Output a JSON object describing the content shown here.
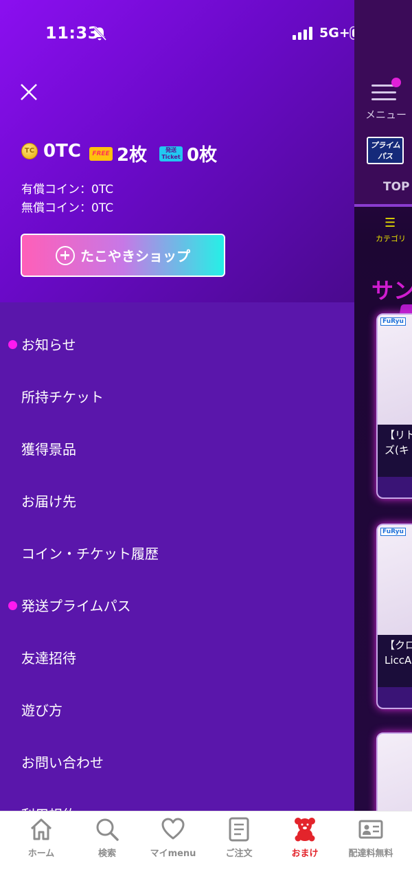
{
  "status_bar": {
    "time": "11:33",
    "network": "5G+"
  },
  "background": {
    "menu_label": "メニュー",
    "prime_badge": "プライム パス",
    "top_tab": "TOP",
    "category_label": "カテゴリ",
    "section_title": "サン",
    "cards": [
      {
        "brand": "FuRyu",
        "text_line1": "【リト",
        "text_line2": "ズ(キ"
      },
      {
        "brand": "FuRyu",
        "text_line1": "【クロ",
        "text_line2": "LiccA"
      }
    ]
  },
  "drawer": {
    "balances": [
      {
        "icon": "tc-coin-icon",
        "icon_text": "TC",
        "value": "0TC"
      },
      {
        "icon": "free-ticket-icon",
        "icon_text": "FREE",
        "value": "2枚"
      },
      {
        "icon": "ship-ticket-icon",
        "icon_text": "発送 Ticket",
        "value": "0枚"
      }
    ],
    "paid_coins": "有償コイン：0TC",
    "free_coins": "無償コイン：0TC",
    "shop_button": "たこやきショップ",
    "menu_items": [
      {
        "label": "お知らせ",
        "dot": true
      },
      {
        "label": "所持チケット",
        "dot": false
      },
      {
        "label": "獲得景品",
        "dot": false
      },
      {
        "label": "お届け先",
        "dot": false
      },
      {
        "label": "コイン・チケット履歴",
        "dot": false
      },
      {
        "label": "発送プライムパス",
        "dot": true
      },
      {
        "label": "友達招待",
        "dot": false
      },
      {
        "label": "遊び方",
        "dot": false
      },
      {
        "label": "お問い合わせ",
        "dot": false
      },
      {
        "label": "利用規約",
        "dot": false
      }
    ]
  },
  "bottom_nav": [
    {
      "label": "ホーム",
      "icon": "home-icon",
      "active": false
    },
    {
      "label": "検索",
      "icon": "search-icon",
      "active": false
    },
    {
      "label": "マイmenu",
      "icon": "heart-icon",
      "active": false
    },
    {
      "label": "ご注文",
      "icon": "document-icon",
      "active": false
    },
    {
      "label": "おまけ",
      "icon": "teddy-bear-icon",
      "active": true
    },
    {
      "label": "配達料無料",
      "icon": "id-card-icon",
      "active": false
    }
  ],
  "colors": {
    "drawer_top_start": "#8b0ff0",
    "drawer_list_bg": "#5a16ab",
    "notification_dot": "#ff19f0",
    "nav_active": "#e3242b",
    "nav_inactive": "#8c8c8c"
  }
}
